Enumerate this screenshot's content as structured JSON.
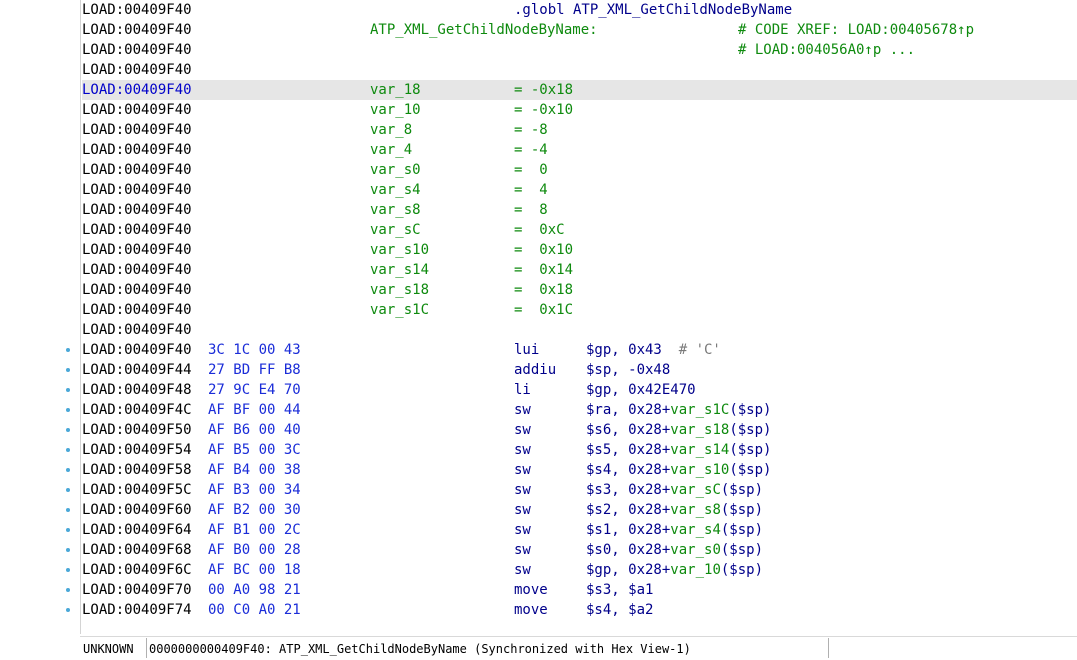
{
  "status_bar": {
    "segment_type": "UNKNOWN",
    "location_text": "0000000000409F40: ATP_XML_GetChildNodeByName (Synchronized with Hex View-1)"
  },
  "listing": [
    {
      "addr": "LOAD:00409F40",
      "directive": ".globl ATP_XML_GetChildNodeByName"
    },
    {
      "addr": "LOAD:00409F40",
      "label": "ATP_XML_GetChildNodeByName:",
      "xref": "# CODE XREF: LOAD:00405678↑p"
    },
    {
      "addr": "LOAD:00409F40",
      "xref": "# LOAD:004056A0↑p ..."
    },
    {
      "addr": "LOAD:00409F40"
    },
    {
      "addr": "LOAD:00409F40",
      "var": "var_18",
      "value": "= -0x18",
      "highlighted": true
    },
    {
      "addr": "LOAD:00409F40",
      "var": "var_10",
      "value": "= -0x10"
    },
    {
      "addr": "LOAD:00409F40",
      "var": "var_8",
      "value": "= -8"
    },
    {
      "addr": "LOAD:00409F40",
      "var": "var_4",
      "value": "= -4"
    },
    {
      "addr": "LOAD:00409F40",
      "var": "var_s0",
      "value": "=  0"
    },
    {
      "addr": "LOAD:00409F40",
      "var": "var_s4",
      "value": "=  4"
    },
    {
      "addr": "LOAD:00409F40",
      "var": "var_s8",
      "value": "=  8"
    },
    {
      "addr": "LOAD:00409F40",
      "var": "var_sC",
      "value": "=  0xC"
    },
    {
      "addr": "LOAD:00409F40",
      "var": "var_s10",
      "value": "=  0x10"
    },
    {
      "addr": "LOAD:00409F40",
      "var": "var_s14",
      "value": "=  0x14"
    },
    {
      "addr": "LOAD:00409F40",
      "var": "var_s18",
      "value": "=  0x18"
    },
    {
      "addr": "LOAD:00409F40",
      "var": "var_s1C",
      "value": "=  0x1C"
    },
    {
      "addr": "LOAD:00409F40"
    },
    {
      "addr": "LOAD:00409F40",
      "bytes": "3C 1C 00 43",
      "mnem": "lui",
      "ops": [
        [
          "$gp, 0x43  ",
          ""
        ],
        [
          "# 'C'",
          "chr"
        ]
      ],
      "dot": true
    },
    {
      "addr": "LOAD:00409F44",
      "bytes": "27 BD FF B8",
      "mnem": "addiu",
      "ops": [
        [
          "$sp, -0x48",
          ""
        ]
      ],
      "dot": true
    },
    {
      "addr": "LOAD:00409F48",
      "bytes": "27 9C E4 70",
      "mnem": "li",
      "ops": [
        [
          "$gp, 0x42E470",
          ""
        ]
      ],
      "dot": true
    },
    {
      "addr": "LOAD:00409F4C",
      "bytes": "AF BF 00 44",
      "mnem": "sw",
      "ops": [
        [
          "$ra, 0x28+",
          ""
        ],
        [
          "var_s1C",
          "var"
        ],
        [
          "($sp)",
          ""
        ]
      ],
      "dot": true
    },
    {
      "addr": "LOAD:00409F50",
      "bytes": "AF B6 00 40",
      "mnem": "sw",
      "ops": [
        [
          "$s6, 0x28+",
          ""
        ],
        [
          "var_s18",
          "var"
        ],
        [
          "($sp)",
          ""
        ]
      ],
      "dot": true
    },
    {
      "addr": "LOAD:00409F54",
      "bytes": "AF B5 00 3C",
      "mnem": "sw",
      "ops": [
        [
          "$s5, 0x28+",
          ""
        ],
        [
          "var_s14",
          "var"
        ],
        [
          "($sp)",
          ""
        ]
      ],
      "dot": true
    },
    {
      "addr": "LOAD:00409F58",
      "bytes": "AF B4 00 38",
      "mnem": "sw",
      "ops": [
        [
          "$s4, 0x28+",
          ""
        ],
        [
          "var_s10",
          "var"
        ],
        [
          "($sp)",
          ""
        ]
      ],
      "dot": true
    },
    {
      "addr": "LOAD:00409F5C",
      "bytes": "AF B3 00 34",
      "mnem": "sw",
      "ops": [
        [
          "$s3, 0x28+",
          ""
        ],
        [
          "var_sC",
          "var"
        ],
        [
          "($sp)",
          ""
        ]
      ],
      "dot": true
    },
    {
      "addr": "LOAD:00409F60",
      "bytes": "AF B2 00 30",
      "mnem": "sw",
      "ops": [
        [
          "$s2, 0x28+",
          ""
        ],
        [
          "var_s8",
          "var"
        ],
        [
          "($sp)",
          ""
        ]
      ],
      "dot": true
    },
    {
      "addr": "LOAD:00409F64",
      "bytes": "AF B1 00 2C",
      "mnem": "sw",
      "ops": [
        [
          "$s1, 0x28+",
          ""
        ],
        [
          "var_s4",
          "var"
        ],
        [
          "($sp)",
          ""
        ]
      ],
      "dot": true
    },
    {
      "addr": "LOAD:00409F68",
      "bytes": "AF B0 00 28",
      "mnem": "sw",
      "ops": [
        [
          "$s0, 0x28+",
          ""
        ],
        [
          "var_s0",
          "var"
        ],
        [
          "($sp)",
          ""
        ]
      ],
      "dot": true
    },
    {
      "addr": "LOAD:00409F6C",
      "bytes": "AF BC 00 18",
      "mnem": "sw",
      "ops": [
        [
          "$gp, 0x28+",
          ""
        ],
        [
          "var_10",
          "var"
        ],
        [
          "($sp)",
          ""
        ]
      ],
      "dot": true
    },
    {
      "addr": "LOAD:00409F70",
      "bytes": "00 A0 98 21",
      "mnem": "move",
      "ops": [
        [
          "$s3, $a1",
          ""
        ]
      ],
      "dot": true
    },
    {
      "addr": "LOAD:00409F74",
      "bytes": "00 C0 A0 21",
      "mnem": "move",
      "ops": [
        [
          "$s4, $a2",
          ""
        ]
      ],
      "dot": true
    }
  ]
}
